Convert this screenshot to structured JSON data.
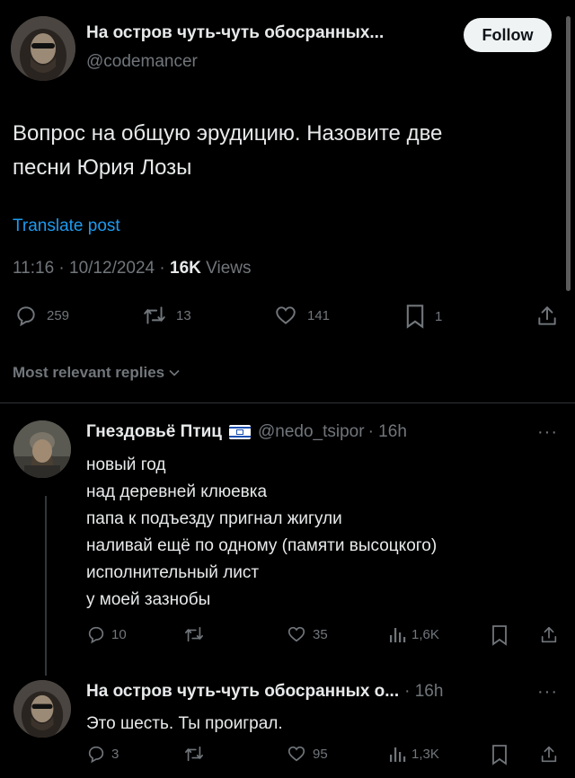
{
  "post": {
    "author_name": "На остров чуть-чуть обосранных...",
    "author_handle": "@codemancer",
    "follow_label": "Follow",
    "text_line1": "Вопрос на общую эрудицию. Назовите две",
    "text_line2": "песни Юрия Лозы",
    "translate_label": "Translate post",
    "timestamp": "11:16 · 10/12/2024 · ",
    "views_count": "16K",
    "views_label": " Views",
    "actions": {
      "replies": "259",
      "reposts": "13",
      "likes": "141",
      "bookmarks": "1"
    }
  },
  "sort": {
    "label": "Most relevant replies"
  },
  "replies": [
    {
      "author_name": "Гнездовьё Птиц",
      "flag": "🇮🇱",
      "handle": "@nedo_tsipor",
      "time": "· 16h",
      "lines": [
        "новый год",
        "над деревней клюевка",
        "папа к подъезду пригнал жигули",
        "наливай ещё по одному (памяти высоцкого)",
        "исполнительный лист",
        "у моей зазнобы"
      ],
      "actions": {
        "replies": "10",
        "reposts": "",
        "likes": "35",
        "views": "1,6K"
      }
    },
    {
      "author_name": "На остров чуть-чуть обосранных о...",
      "time": "· 16h",
      "lines": [
        "Это шесть. Ты проиграл."
      ],
      "actions": {
        "replies": "3",
        "reposts": "",
        "likes": "95",
        "views": "1,3K"
      }
    }
  ],
  "colors": {
    "background": "#000000",
    "text": "#e7e9ea",
    "muted": "#71767b",
    "link": "#1d9bf0",
    "follow_bg": "#eff3f4"
  },
  "icons": [
    "reply-icon",
    "repost-icon",
    "like-icon",
    "bookmark-icon",
    "share-icon",
    "views-icon",
    "more-icon",
    "chevron-down-icon"
  ]
}
